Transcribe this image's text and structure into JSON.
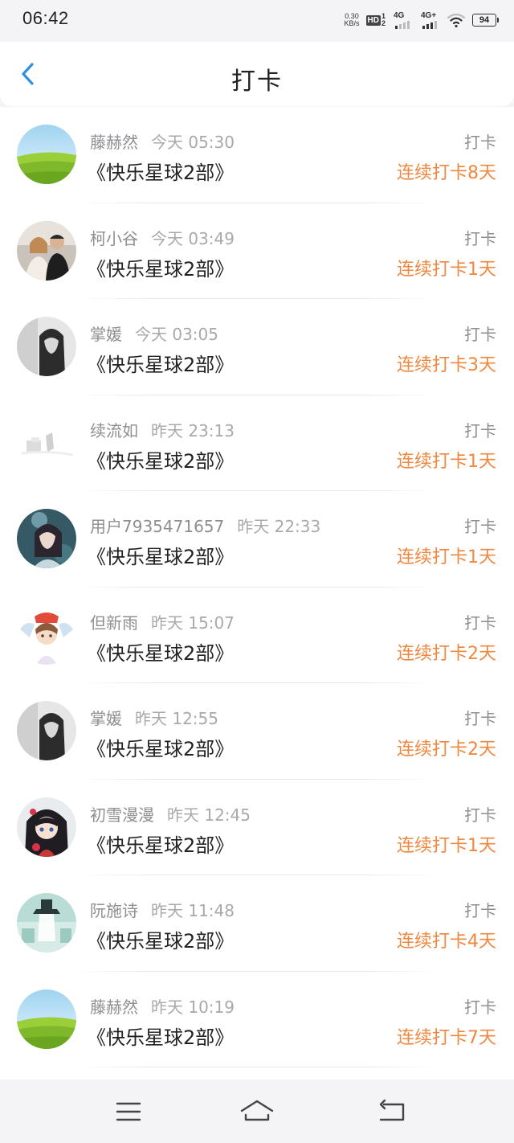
{
  "status_bar": {
    "time": "06:42",
    "net_speed_value": "0.30",
    "net_speed_unit": "KB/s",
    "hd_label": "HD",
    "hd_sim_top": "1",
    "hd_sim_bottom": "2",
    "sim1_label": "4G",
    "sim2_label": "4G+",
    "wifi_icon": "wifi-icon",
    "battery_level": "94"
  },
  "header": {
    "title": "打卡",
    "back_icon": "chevron-left-icon",
    "accent_color": "#2f8fe0"
  },
  "list": {
    "streak_color": "#f0873f",
    "items": [
      {
        "name": "藤赫然",
        "time": "今天 05:30",
        "program": "《快乐星球2部》",
        "action": "打卡",
        "streak": "连续打卡8天",
        "avatar": "grassland"
      },
      {
        "name": "柯小谷",
        "time": "今天 03:49",
        "program": "《快乐星球2部》",
        "action": "打卡",
        "streak": "连续打卡1天",
        "avatar": "couple"
      },
      {
        "name": "掌媛",
        "time": "今天 03:05",
        "program": "《快乐星球2部》",
        "action": "打卡",
        "streak": "连续打卡3天",
        "avatar": "girl-bw"
      },
      {
        "name": "续流如",
        "time": "昨天 23:13",
        "program": "《快乐星球2部》",
        "action": "打卡",
        "streak": "连续打卡1天",
        "avatar": "white-sketch"
      },
      {
        "name": "用户7935471657",
        "time": "昨天 22:33",
        "program": "《快乐星球2部》",
        "action": "打卡",
        "streak": "连续打卡1天",
        "avatar": "girl-teal"
      },
      {
        "name": "但新雨",
        "time": "昨天 15:07",
        "program": "《快乐星球2部》",
        "action": "打卡",
        "streak": "连续打卡2天",
        "avatar": "anime-boy"
      },
      {
        "name": "掌媛",
        "time": "昨天 12:55",
        "program": "《快乐星球2部》",
        "action": "打卡",
        "streak": "连续打卡2天",
        "avatar": "girl-bw"
      },
      {
        "name": "初雪漫漫",
        "time": "昨天 12:45",
        "program": "《快乐星球2部》",
        "action": "打卡",
        "streak": "连续打卡1天",
        "avatar": "anime-girl"
      },
      {
        "name": "阮施诗",
        "time": "昨天 11:48",
        "program": "《快乐星球2部》",
        "action": "打卡",
        "streak": "连续打卡4天",
        "avatar": "hat-figure"
      },
      {
        "name": "藤赫然",
        "time": "昨天 10:19",
        "program": "《快乐星球2部》",
        "action": "打卡",
        "streak": "连续打卡7天",
        "avatar": "grassland"
      }
    ]
  },
  "nav_bar": {
    "menu_icon": "menu-icon",
    "home_icon": "home-icon",
    "back_icon": "back-arrow-icon"
  }
}
